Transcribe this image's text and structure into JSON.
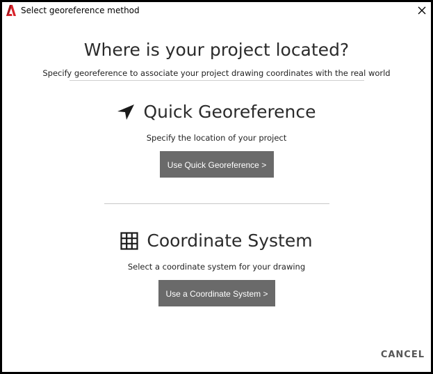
{
  "window": {
    "title": "Select georeference method",
    "app_icon": "autocad-a-icon",
    "close_icon": "close-icon"
  },
  "header": {
    "title": "Where is your project located?",
    "subtitle": "Specify georeference to associate your project drawing coordinates with the real world"
  },
  "quick": {
    "icon": "navigation-arrow-icon",
    "title": "Quick Georeference",
    "description": "Specify the location of your project",
    "button_label": "Use Quick Georeference >"
  },
  "coordinate": {
    "icon": "grid-icon",
    "title": "Coordinate System",
    "description": "Select a coordinate system for your drawing",
    "button_label": "Use a Coordinate System >"
  },
  "footer": {
    "cancel_label": "CANCEL"
  },
  "colors": {
    "app_icon_red": "#d8232a",
    "button_bg": "#6a6a6a",
    "button_text": "#ffffff",
    "heading_text": "#2b2b2b",
    "cancel_text": "#555555"
  }
}
